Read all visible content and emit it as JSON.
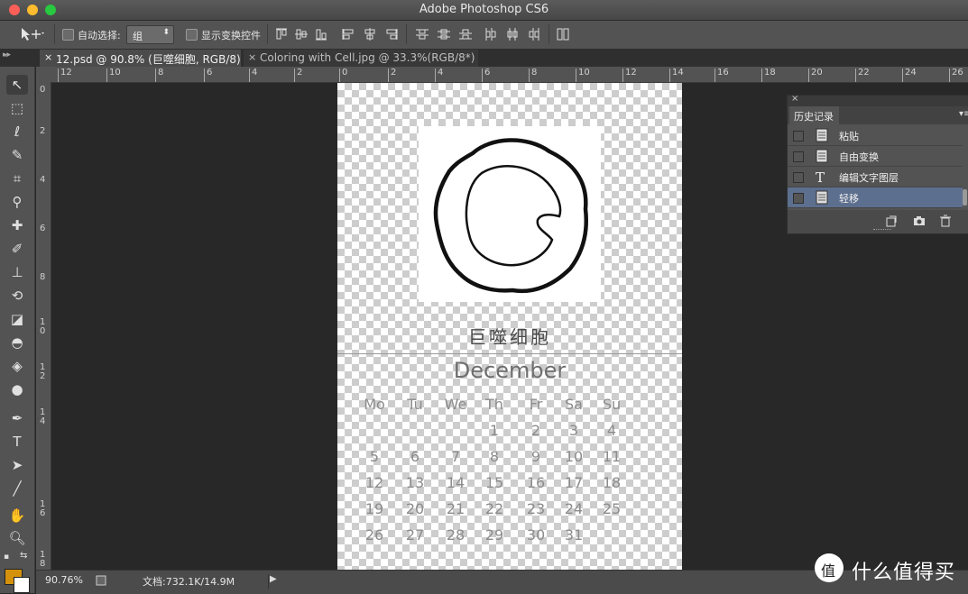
{
  "window": {
    "title": "Adobe Photoshop CS6"
  },
  "options": {
    "auto_select_label": "自动选择:",
    "auto_select_value": "组",
    "show_transform_label": "显示变换控件"
  },
  "tabs": [
    {
      "label": "12.psd @ 90.8% (巨噬细胞, RGB/8)",
      "active": true
    },
    {
      "label": "Coloring with Cell.jpg @ 33.3%(RGB/8*)",
      "active": false
    }
  ],
  "hruler_labels": [
    "12",
    "10",
    "8",
    "6",
    "4",
    "2",
    "0",
    "2",
    "4",
    "6",
    "8",
    "10",
    "12",
    "14",
    "16",
    "18",
    "20",
    "22",
    "24",
    "26"
  ],
  "vruler_labels": [
    "0",
    "2",
    "4",
    "6",
    "8",
    "1\n0",
    "1\n2",
    "1\n4",
    "1\n6",
    "1\n8"
  ],
  "canvas": {
    "title": "巨噬细胞",
    "month": "December",
    "weekdays": [
      "Mo",
      "Tu",
      "We",
      "Th",
      "Fr",
      "Sa",
      "Su"
    ],
    "weeks": [
      [
        "",
        "",
        "",
        "1",
        "2",
        "3",
        "4"
      ],
      [
        "5",
        "6",
        "7",
        "8",
        "9",
        "10",
        "11"
      ],
      [
        "12",
        "13",
        "14",
        "15",
        "16",
        "17",
        "18"
      ],
      [
        "19",
        "20",
        "21",
        "22",
        "23",
        "24",
        "25"
      ],
      [
        "26",
        "27",
        "28",
        "29",
        "30",
        "31",
        ""
      ]
    ]
  },
  "history": {
    "tab_label": "历史记录",
    "items": [
      {
        "label": "粘贴",
        "icon": "document-icon",
        "selected": false
      },
      {
        "label": "自由变换",
        "icon": "document-icon",
        "selected": false
      },
      {
        "label": "编辑文字图层",
        "icon": "text-tool-icon",
        "selected": false
      },
      {
        "label": "轻移",
        "icon": "document-icon",
        "selected": true
      }
    ]
  },
  "status": {
    "zoom": "90.76%",
    "doc_size": "文档:732.1K/14.9M"
  },
  "colors": {
    "foreground": "#d4920c",
    "background": "#ffffff",
    "history_selected": "#5d6f8e"
  },
  "watermark": {
    "text": "什么值得买",
    "logo_char": "值"
  }
}
